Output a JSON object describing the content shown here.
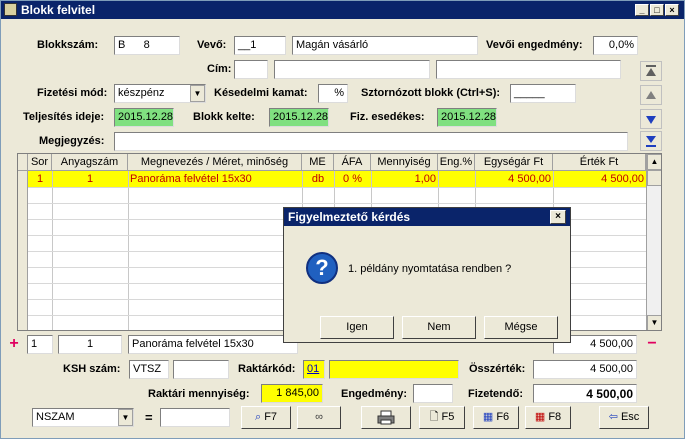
{
  "window": {
    "title": "Blokk felvitel"
  },
  "header": {
    "blokkszam_label": "Blokkszám:",
    "blokkszam_value": "B      8",
    "vevo_label": "Vevő:",
    "vevo_code": "__1",
    "vevo_name": "Magán vásárló",
    "vevoi_engedmeny_label": "Vevői engedmény:",
    "vevoi_engedmeny_value": "0,0%",
    "cim_label": "Cím:",
    "fizetesi_mod_label": "Fizetési mód:",
    "fizetesi_mod_value": "készpénz",
    "kesedelmi_kamat_label": "Késedelmi kamat:",
    "kesedelmi_kamat_value": "%",
    "sztornozott_label": "Sztornózott blokk (Ctrl+S):",
    "sztornozott_value": "_____",
    "teljesites_label": "Teljesítés ideje:",
    "teljesites_value": "2015.12.28",
    "blokk_kelte_label": "Blokk kelte:",
    "blokk_kelte_value": "2015.12.28",
    "fiz_esedekes_label": "Fiz. esedékes:",
    "fiz_esedekes_value": "2015.12.28",
    "megjegyzes_label": "Megjegyzés:"
  },
  "table": {
    "columns": [
      "Sor",
      "Anyagszám",
      "Megnevezés / Méret, minőség",
      "ME",
      "ÁFA",
      "Mennyiség",
      "Eng.%",
      "Egységár Ft",
      "Érték Ft"
    ],
    "rows": [
      [
        "1",
        "1",
        "Panoráma felvétel 15x30",
        "db",
        "0 %",
        "1,00",
        "",
        "4 500,00",
        "4 500,00"
      ]
    ]
  },
  "edit_row": {
    "sor": "1",
    "anyagszam": "1",
    "megnevezes": "Panoráma felvétel 15x30",
    "ertek": "4 500,00"
  },
  "footer": {
    "ksh_label": "KSH szám:",
    "ksh_value": "VTSZ",
    "raktarkod_label": "Raktárkód:",
    "raktarkod_value": "01",
    "osszertek_label": "Összérték:",
    "osszertek_value": "4 500,00",
    "raktari_mennyiseg_label": "Raktári mennyiség:",
    "raktari_mennyiseg_value": "1 845,00",
    "engedmeny_label": "Engedmény:",
    "fizetendo_label": "Fizetendő:",
    "fizetendo_value": "4 500,00"
  },
  "toolbar": {
    "nszam_value": "NSZAM",
    "equals": "=",
    "f7_label": "F7",
    "f5_label": "F5",
    "f6_label": "F6",
    "f8_label": "F8",
    "esc_label": "Esc"
  },
  "dialog": {
    "title": "Figyelmeztető kérdés",
    "message": "1. példány nyomtatása rendben ?",
    "yes_label": "Igen",
    "no_label": "Nem",
    "cancel_label": "Mégse"
  }
}
